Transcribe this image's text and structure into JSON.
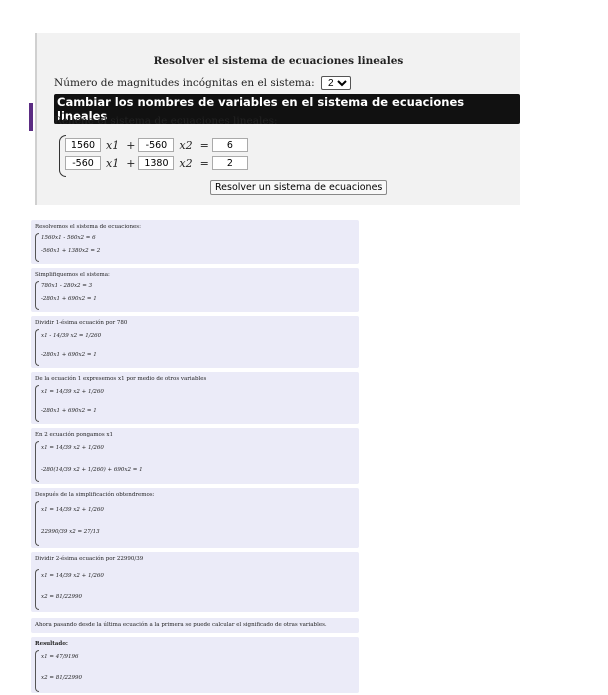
{
  "form": {
    "title": "Resolver el sistema de ecuaciones lineales",
    "unknowns_label": "Número de magnitudes incógnitas en el sistema:",
    "unknowns_value": "2",
    "rename_label": "Cambiar los nombres de variables en el sistema de ecuaciones lineales",
    "fill_label": "Rellene el sistema de ecuaciones lineales:",
    "row1": {
      "a": "1560",
      "plus": "+",
      "b": "-560",
      "eq": "=",
      "c": "6",
      "x1": "x1",
      "x2": "x2"
    },
    "row2": {
      "a": "-560",
      "plus": "+",
      "b": "1380",
      "eq": "=",
      "c": "2",
      "x1": "x1",
      "x2": "x2"
    },
    "solve_label": "Resolver un sistema de ecuaciones"
  },
  "steps": [
    {
      "title": "Resolvemos el sistema de ecuaciones:",
      "lines": [
        "1560x1 - 560x2 = 6",
        "-560x1 + 1380x2 = 2"
      ]
    },
    {
      "title": "Simplifiquemos el sistema:",
      "lines": [
        "780x1 - 280x2 = 3",
        "-280x1 + 690x2 = 1"
      ]
    },
    {
      "title": "Dividir 1-ésima ecuación por 780",
      "lines": [
        "x1 - 14/39 x2 = 1/260",
        "-280x1 + 690x2 = 1"
      ]
    },
    {
      "title": "De la ecuación 1 expresemos x1 por medio de otros variables",
      "lines": [
        "x1 = 14/39 x2 + 1/260",
        "-280x1 + 690x2 = 1"
      ]
    },
    {
      "title": "En 2 ecuación pongamos x1",
      "lines": [
        "x1 = 14/39 x2 + 1/260",
        "-280(14/39 x2 + 1/260) + 690x2 = 1"
      ]
    },
    {
      "title": "Después de la simplificación obtendremos:",
      "lines": [
        "x1 = 14/39 x2 + 1/260",
        "22990/39 x2 = 27/13"
      ]
    },
    {
      "title": "Dividir 2-ésima ecuación por 22990/39",
      "lines": [
        "x1 = 14/39 x2 + 1/260",
        "x2 = 81/22990"
      ]
    },
    {
      "title": "Ahora pasando desde la última ecuación a la primera se puede calcular el significado de otras variables.",
      "lines": []
    },
    {
      "title": "Resultado:",
      "lines": [
        "x1 = 47/9196",
        "x2 = 81/22990"
      ]
    }
  ]
}
